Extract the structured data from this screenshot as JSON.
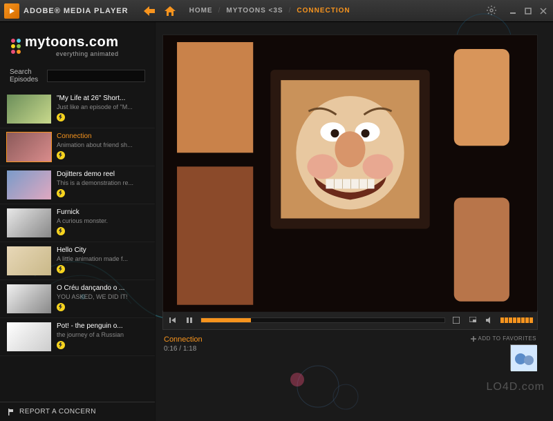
{
  "app": {
    "title": "ADOBE® MEDIA PLAYER"
  },
  "breadcrumb": {
    "home": "HOME",
    "channel": "MYTOONS <3S",
    "current": "CONNECTION"
  },
  "brand": {
    "name": "mytoons.com",
    "tagline": "everything animated",
    "dot_colors": [
      "#e94e77",
      "#4ecde9",
      "#f7d41e",
      "#8bc34a",
      "#e94e77",
      "#f7941e"
    ]
  },
  "search": {
    "label": "Search Episodes",
    "value": ""
  },
  "episodes": [
    {
      "title": "\"My Life at 26\" Short...",
      "desc": "Just like an episode of \"M...",
      "selected": false,
      "thumb_bg": "linear-gradient(135deg,#6b8e5a,#c9d98c)"
    },
    {
      "title": "Connection",
      "desc": "Animation about friend sh...",
      "selected": true,
      "thumb_bg": "linear-gradient(135deg,#8b5a5a,#d98c8c)"
    },
    {
      "title": "Dojitters demo reel",
      "desc": "This is a demonstration re...",
      "selected": false,
      "thumb_bg": "linear-gradient(135deg,#7a9bc9,#e0a8c0)"
    },
    {
      "title": "Furnick",
      "desc": "A curious monster.",
      "selected": false,
      "thumb_bg": "linear-gradient(135deg,#e8e8e8,#888)"
    },
    {
      "title": "Hello City",
      "desc": "A little animation made f...",
      "selected": false,
      "thumb_bg": "linear-gradient(135deg,#e8d8b8,#c9b888)"
    },
    {
      "title": "O Créu dançando o ...",
      "desc": "YOU ASKED, WE DID IT!",
      "selected": false,
      "thumb_bg": "linear-gradient(135deg,#f0f0f0,#888)"
    },
    {
      "title": "Pot! - the penguin o...",
      "desc": "the journey of a Russian",
      "selected": false,
      "thumb_bg": "linear-gradient(135deg,#fff,#ccc)"
    }
  ],
  "report": {
    "label": "REPORT A CONCERN"
  },
  "video": {
    "title": "Connection",
    "current_time": "0:16",
    "duration": "1:18",
    "progress_pct": 20.5,
    "favorites_label": "ADD TO FAVORITES"
  },
  "watermark": "LO4D.com"
}
